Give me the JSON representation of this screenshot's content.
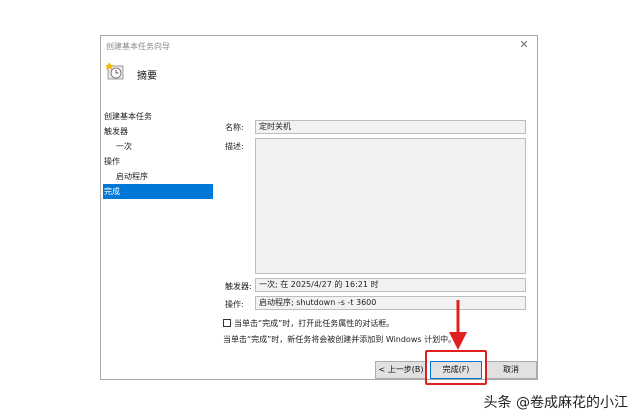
{
  "window": {
    "title": "创建基本任务向导",
    "close_glyph": "✕",
    "header_title": "摘要"
  },
  "nav": {
    "items": [
      {
        "label": "创建基本任务"
      },
      {
        "label": "触发器"
      },
      {
        "label": "一次"
      },
      {
        "label": "操作"
      },
      {
        "label": "启动程序"
      },
      {
        "label": "完成"
      }
    ]
  },
  "summary": {
    "name_label": "名称:",
    "name_value": "定时关机",
    "desc_label": "描述:",
    "desc_value": "",
    "trigger_label": "触发器:",
    "trigger_value": "一次; 在 2025/4/27 的 16:21 时",
    "action_label": "操作:",
    "action_value": "启动程序; shutdown -s -t 3600"
  },
  "options": {
    "open_props_label": "当单击“完成”时，打开此任务属性的对话框。",
    "open_props_checked": false,
    "note": "当单击“完成”时，新任务将会被创建并添加到 Windows 计划中。"
  },
  "buttons": {
    "back": "< 上一步(B)",
    "finish": "完成(F)",
    "cancel": "取消"
  },
  "watermark": "头条 @卷成麻花的小江",
  "colors": {
    "accent": "#0078d7",
    "highlight": "#e02020"
  }
}
